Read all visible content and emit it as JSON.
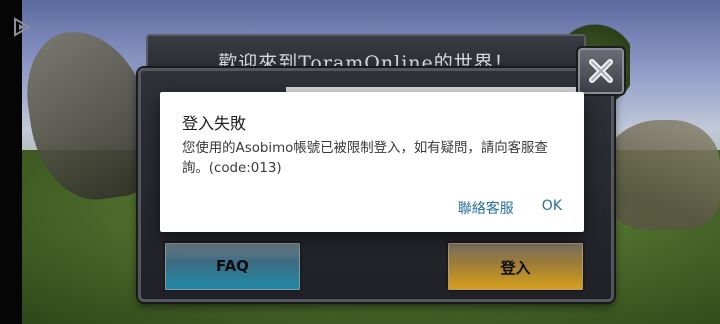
{
  "game": {
    "title": "歡迎來到ToramOnline的世界！",
    "faq_label": "FAQ",
    "login_label": "登入",
    "close_icon": "close-icon",
    "back_icon": "back-triangle-icon"
  },
  "alert": {
    "title": "登入失敗",
    "message": "您使用的Asobimo帳號已被限制登入，如有疑問，請向客服查詢。(code:013)",
    "contact_label": "聯絡客服",
    "ok_label": "OK"
  },
  "colors": {
    "alert_action": "#2a6f9a",
    "faq_button": "#1e8aa8",
    "login_button": "#d9a21c"
  }
}
